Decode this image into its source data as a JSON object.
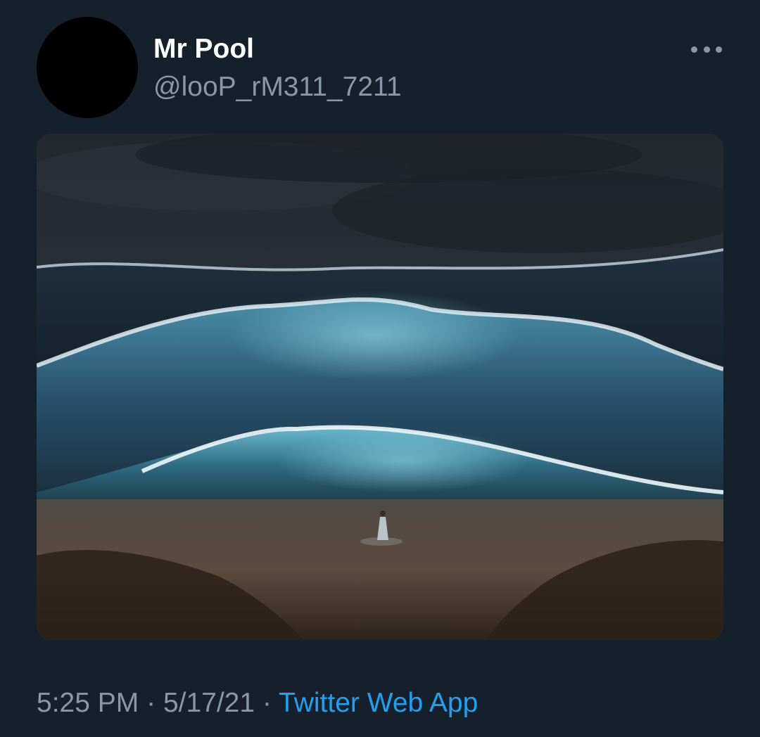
{
  "tweet": {
    "author": {
      "display_name": "Mr Pool",
      "handle": "@looP_rM311_7211"
    },
    "more_icon": "more-horizontal-icon",
    "image": {
      "subject": "storm-waves-painting"
    },
    "time": "5:25 PM",
    "separator": "·",
    "date": "5/17/21",
    "source": "Twitter Web App"
  },
  "colors": {
    "background": "#15202b",
    "primary_text": "#ffffff",
    "secondary_text": "#8899a6",
    "link": "#1da1f2"
  }
}
